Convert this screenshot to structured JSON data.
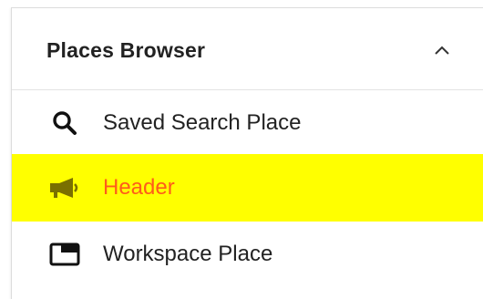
{
  "panel": {
    "title": "Places Browser",
    "collapse_icon": "chevron-up-icon"
  },
  "places": [
    {
      "label": "Saved Search Place",
      "icon": "search-icon",
      "selected": false
    },
    {
      "label": "Header",
      "icon": "megaphone-icon",
      "selected": true
    },
    {
      "label": "Workspace Place",
      "icon": "window-icon",
      "selected": false
    }
  ],
  "colors": {
    "selected_background": "#ffff00",
    "selected_text": "#ff5c1a",
    "selected_icon": "#7a7000",
    "text": "#222222"
  }
}
